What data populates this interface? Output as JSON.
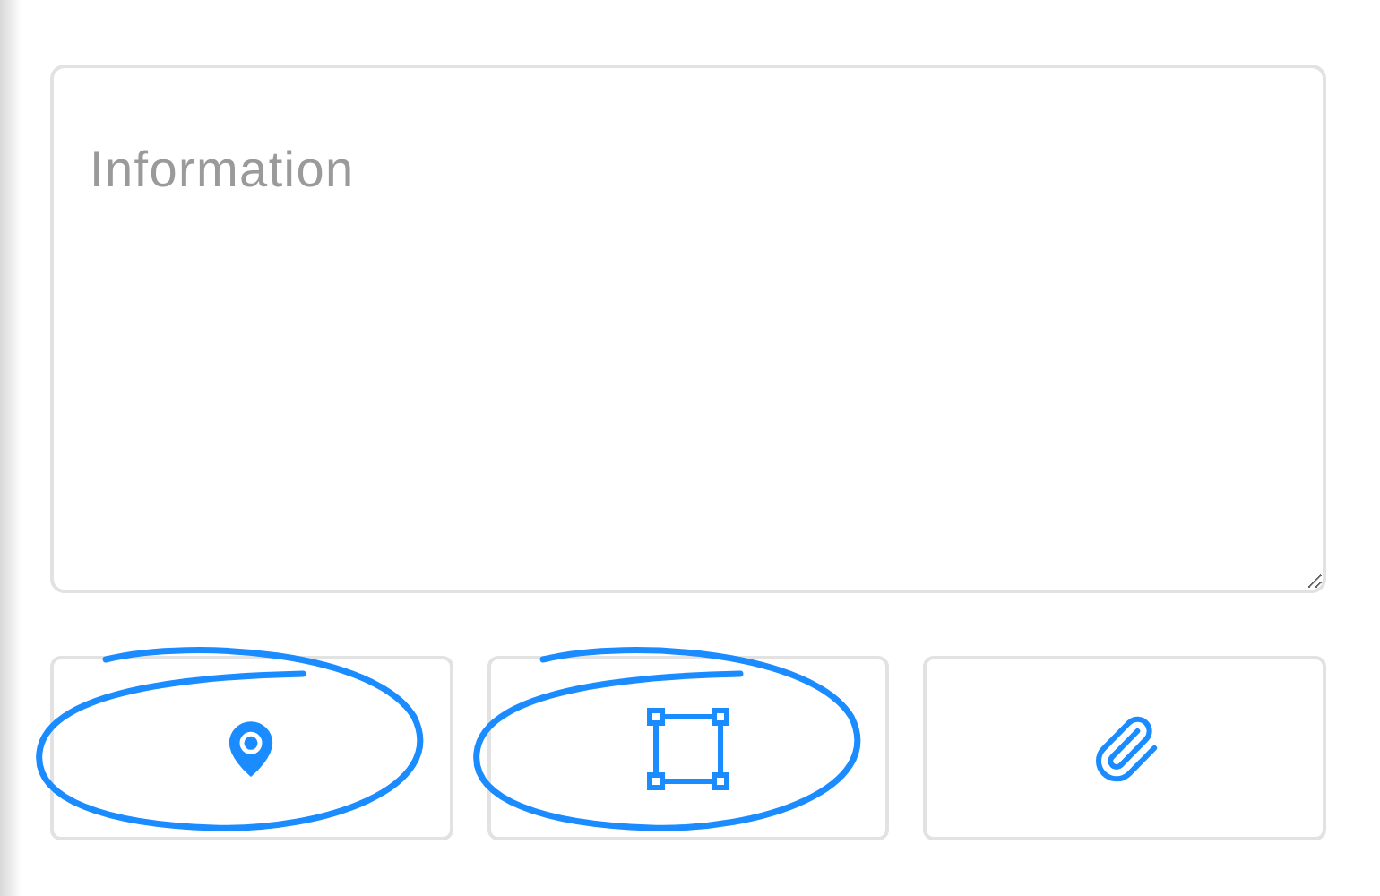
{
  "information": {
    "placeholder": "Information"
  },
  "buttons": [
    {
      "kind": "location",
      "circled": true
    },
    {
      "kind": "area",
      "circled": true
    },
    {
      "kind": "attachment",
      "circled": false
    }
  ]
}
